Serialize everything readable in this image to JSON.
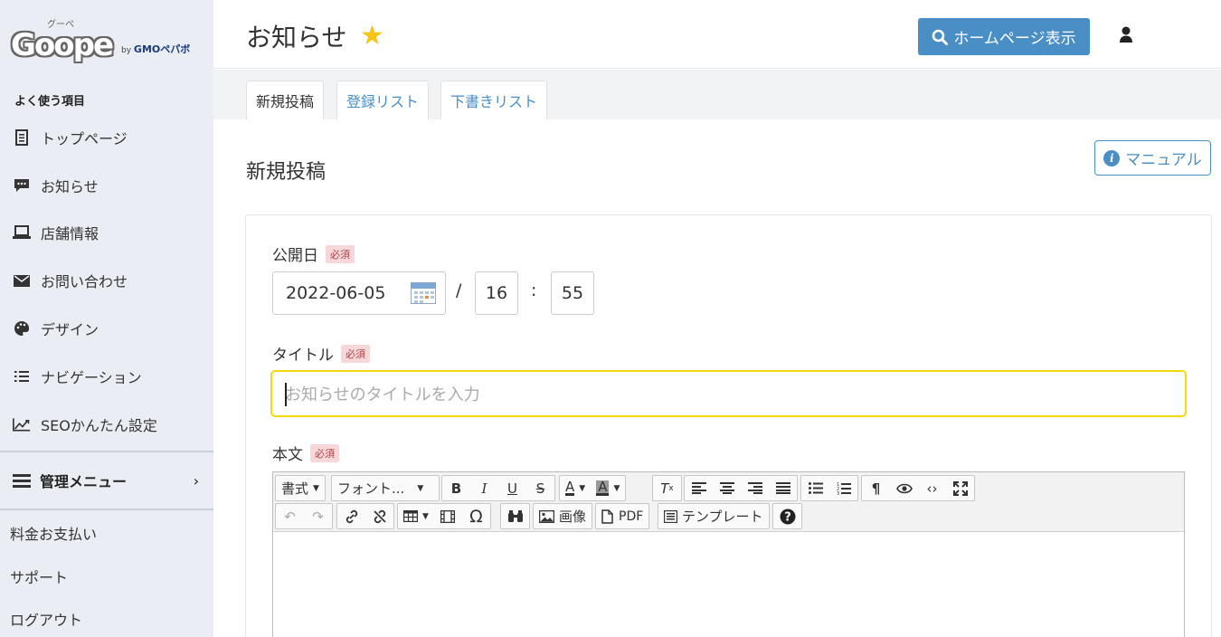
{
  "logo": {
    "ruby": "グーペ",
    "word": "Goope",
    "by": "by",
    "brand": "GMOペパボ"
  },
  "sidebar": {
    "section_title": "よく使う項目",
    "items": [
      {
        "label": "トップページ",
        "icon": "document-icon"
      },
      {
        "label": "お知らせ",
        "icon": "chat-icon"
      },
      {
        "label": "店舗情報",
        "icon": "laptop-icon"
      },
      {
        "label": "お問い合わせ",
        "icon": "mail-icon"
      },
      {
        "label": "デザイン",
        "icon": "palette-icon"
      },
      {
        "label": "ナビゲーション",
        "icon": "list-icon"
      },
      {
        "label": "SEOかんたん設定",
        "icon": "chart-line-icon"
      }
    ],
    "admin_menu": "管理メニュー",
    "sub_items": [
      "料金お支払い",
      "サポート",
      "ログアウト"
    ]
  },
  "header": {
    "title": "お知らせ",
    "homepage_button": "ホームページ表示"
  },
  "tabs": [
    "新規投稿",
    "登録リスト",
    "下書きリスト"
  ],
  "main": {
    "section_title": "新規投稿",
    "manual_button": "マニュアル",
    "required_badge": "必須",
    "publish_date_label": "公開日",
    "date": "2022-06-05",
    "date_separator": "/",
    "hour": "16",
    "time_separator": ":",
    "minute": "55",
    "title_label": "タイトル",
    "title_placeholder": "お知らせのタイトルを入力",
    "body_label": "本文"
  },
  "editor": {
    "format_label": "書式",
    "font_label": "フォント...",
    "image_label": "画像",
    "pdf_label": "PDF",
    "template_label": "テンプレート"
  },
  "colors": {
    "accent": "#4a8ec6",
    "star": "#f5c518",
    "focus_border": "#f5d90a",
    "sidebar_bg": "#eaedf3"
  }
}
